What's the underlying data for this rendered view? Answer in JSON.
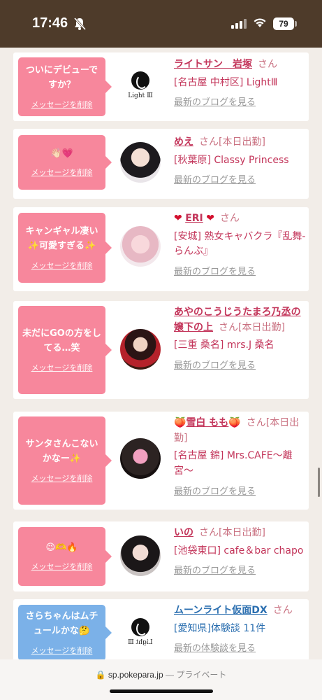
{
  "status": {
    "time": "17:46",
    "battery": "79"
  },
  "messages": [
    {
      "bubble_text": "ついにデビューですか？",
      "delete_label": "メッセージを削除",
      "name": "ライトサン　岩塚",
      "name_suffix": "",
      "san": "さん",
      "shop": "[名古屋 中村区] LightⅢ",
      "blog_label": "最新のブログを見る",
      "avatar": "logo",
      "logo_text": "Light Ⅲ"
    },
    {
      "bubble_text": "👋🏻💗",
      "delete_label": "メッセージを削除",
      "name": "めえ",
      "san": "さん[本日出勤]",
      "shop": "[秋葉原] Classy Princess",
      "blog_label": "最新のブログを見る",
      "avatar": "photo"
    },
    {
      "bubble_text": "キャンギャル凄い✨可愛すぎる✨",
      "delete_label": "メッセージを削除",
      "name": "ERI",
      "san": "さん",
      "shop": "[安城] 熟女キャバクラ『乱舞-らんぶ』",
      "blog_label": "最新のブログを見る",
      "avatar": "photo"
    },
    {
      "bubble_text": "未だにGOの方をしてる…笑",
      "delete_label": "メッセージを削除",
      "name": "あやのこうじうたまろ乃丞の嬢下の上",
      "san": "さん[本日出勤]",
      "shop": "[三重 桑名] mrs.J 桑名",
      "blog_label": "最新のブログを見る",
      "avatar": "photo"
    },
    {
      "bubble_text": "サンタさんこないかなー✨",
      "delete_label": "メッセージを削除",
      "name": "雪白 もも",
      "san": "さん[本日出勤]",
      "shop": "[名古屋 錦] Mrs.CAFE〜離宮〜",
      "blog_label": "最新のブログを見る",
      "avatar": "photo"
    },
    {
      "bubble_text": "😉🫶🔥",
      "delete_label": "メッセージを削除",
      "name": "いの",
      "san": "さん[本日出勤]",
      "shop": "[池袋東口] cafe＆bar chapo",
      "blog_label": "最新のブログを見る",
      "avatar": "photo"
    },
    {
      "bubble_text": "さらちゃんはムチュールかな🤔",
      "delete_label": "メッセージを削除",
      "name": "ムーンライト仮面DX",
      "san": "さん",
      "shop": "[愛知県]体験談 11件",
      "blog_label": "最新の体験談を見る",
      "avatar": "logo",
      "logo_text": "Light Ⅲ"
    }
  ],
  "url_bar": {
    "domain": "sp.pokepara.jp",
    "separator": "—",
    "mode": "プライベート"
  }
}
